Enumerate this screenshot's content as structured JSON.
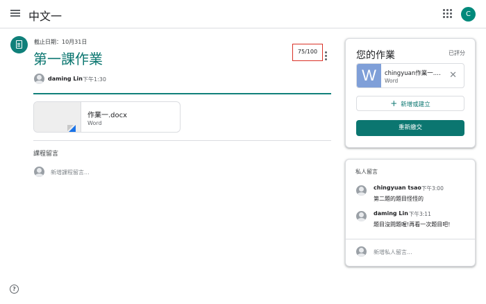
{
  "header": {
    "class_name": "中文一",
    "avatar_letter": "C"
  },
  "assignment": {
    "due": "截止日期：10月31日",
    "title": "第一課作業",
    "score": "75/100",
    "author": "daming Lin",
    "posted_time": "下午1:30",
    "attachment": {
      "name": "作業一.docx",
      "type": "Word"
    }
  },
  "class_comments": {
    "heading": "課程留言",
    "placeholder": "新增課程留言..."
  },
  "your_work": {
    "title": "您的作業",
    "status": "已評分",
    "file": {
      "icon_letter": "W",
      "name": "chingyuan作業一.docx",
      "type": "Word"
    },
    "add_label": "新增或建立",
    "resubmit_label": "重新繳交"
  },
  "private_comments": {
    "heading": "私人留言",
    "comments": [
      {
        "author": "chingyuan tsao",
        "time": "下午3:00",
        "text": "第二題的題目怪怪的"
      },
      {
        "author": "daming Lin",
        "time": "下午3:11",
        "text": "題目沒問題喔!再看一次題目吧!"
      }
    ],
    "placeholder": "新增私人留言..."
  },
  "help_label": "?",
  "colors": {
    "accent": "#0b7670",
    "score_border": "#d93025",
    "word_blue": "#7f9fd8"
  }
}
